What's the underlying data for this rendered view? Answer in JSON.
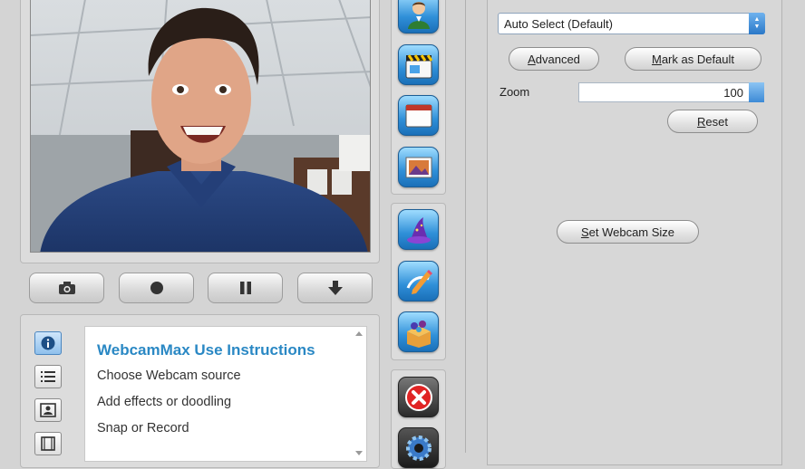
{
  "controls": {
    "snapshot": "camera-icon",
    "record": "record-icon",
    "pause": "pause-icon",
    "download": "download-icon"
  },
  "instructions": {
    "title": "WebcamMax Use Instructions",
    "lines": [
      "Choose Webcam source",
      "Add effects or doodling",
      "Snap or Record"
    ]
  },
  "side_tabs": [
    "info-icon",
    "list-icon",
    "portrait-icon",
    "film-icon"
  ],
  "toolbar": {
    "group1": [
      "webcam-user-icon",
      "clapperboard-icon",
      "window-icon",
      "picture-icon"
    ],
    "group2": [
      "wizard-hat-icon",
      "doodle-pencil-icon",
      "effects-box-icon"
    ],
    "group3": [
      "close-icon",
      "gear-icon"
    ]
  },
  "settings": {
    "source_select": "Auto Select (Default)",
    "advanced_label": "Advanced",
    "advanced_key": "A",
    "mark_default_label": "Mark as Default",
    "mark_default_key": "M",
    "zoom_label": "Zoom",
    "zoom_value": "100",
    "reset_label": "Reset",
    "reset_key": "R",
    "webcam_size_label": "Set Webcam Size",
    "webcam_size_key": "S"
  },
  "colors": {
    "accent": "#2a88c4",
    "select_arrow": "#2a78c8"
  }
}
